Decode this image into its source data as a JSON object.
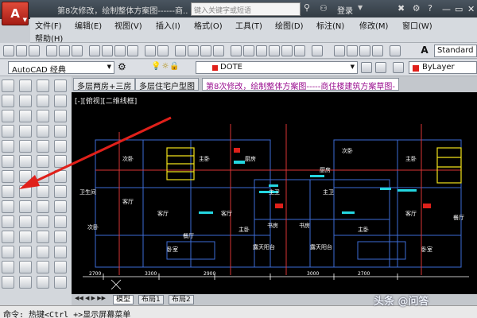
{
  "app": {
    "logo": "A"
  },
  "title_bar": {
    "title": "第8次修改，绘制整体方案图------商...",
    "search_placeholder": "键入关键字或短语",
    "login": "登录",
    "minimize": "—",
    "maximize": "▭",
    "close": "✕"
  },
  "menu": {
    "items": [
      "文件(F)",
      "编辑(E)",
      "视图(V)",
      "插入(I)",
      "格式(O)",
      "工具(T)",
      "绘图(D)",
      "标注(N)",
      "修改(M)",
      "窗口(W)"
    ],
    "help": "帮助(H)"
  },
  "toolbar": {
    "text_style": "A",
    "style": "Standard"
  },
  "toolbar2": {
    "workspace": "AutoCAD 经典",
    "layer": "DOTE",
    "color": "ByLayer"
  },
  "doc_tabs": [
    "多层两房+三房",
    "多层住宅户型图",
    "第8次修改，绘制整体方案图-----商住楼建筑方案草图-"
  ],
  "canvas": {
    "view_label": "[-][俯视][二维线框]",
    "rooms": [
      "次卧",
      "主卧",
      "厨房",
      "次卧",
      "主卧",
      "厨房",
      "卫生间",
      "客厅",
      "客厅",
      "主卫",
      "主卫",
      "客厅",
      "客厅",
      "次卧",
      "书房",
      "主卧",
      "书房",
      "主卧",
      "餐厅",
      "餐厅",
      "卧室",
      "卧室",
      "露天阳台",
      "露天阳台"
    ],
    "dims": [
      "2700",
      "3300",
      "2900",
      "3000",
      "2700"
    ]
  },
  "layout_tabs": [
    "模型",
    "布局1",
    "布局2"
  ],
  "command": "命令: 热键<Ctrl +>显示屏幕菜单",
  "watermark": "头条 @问答"
}
